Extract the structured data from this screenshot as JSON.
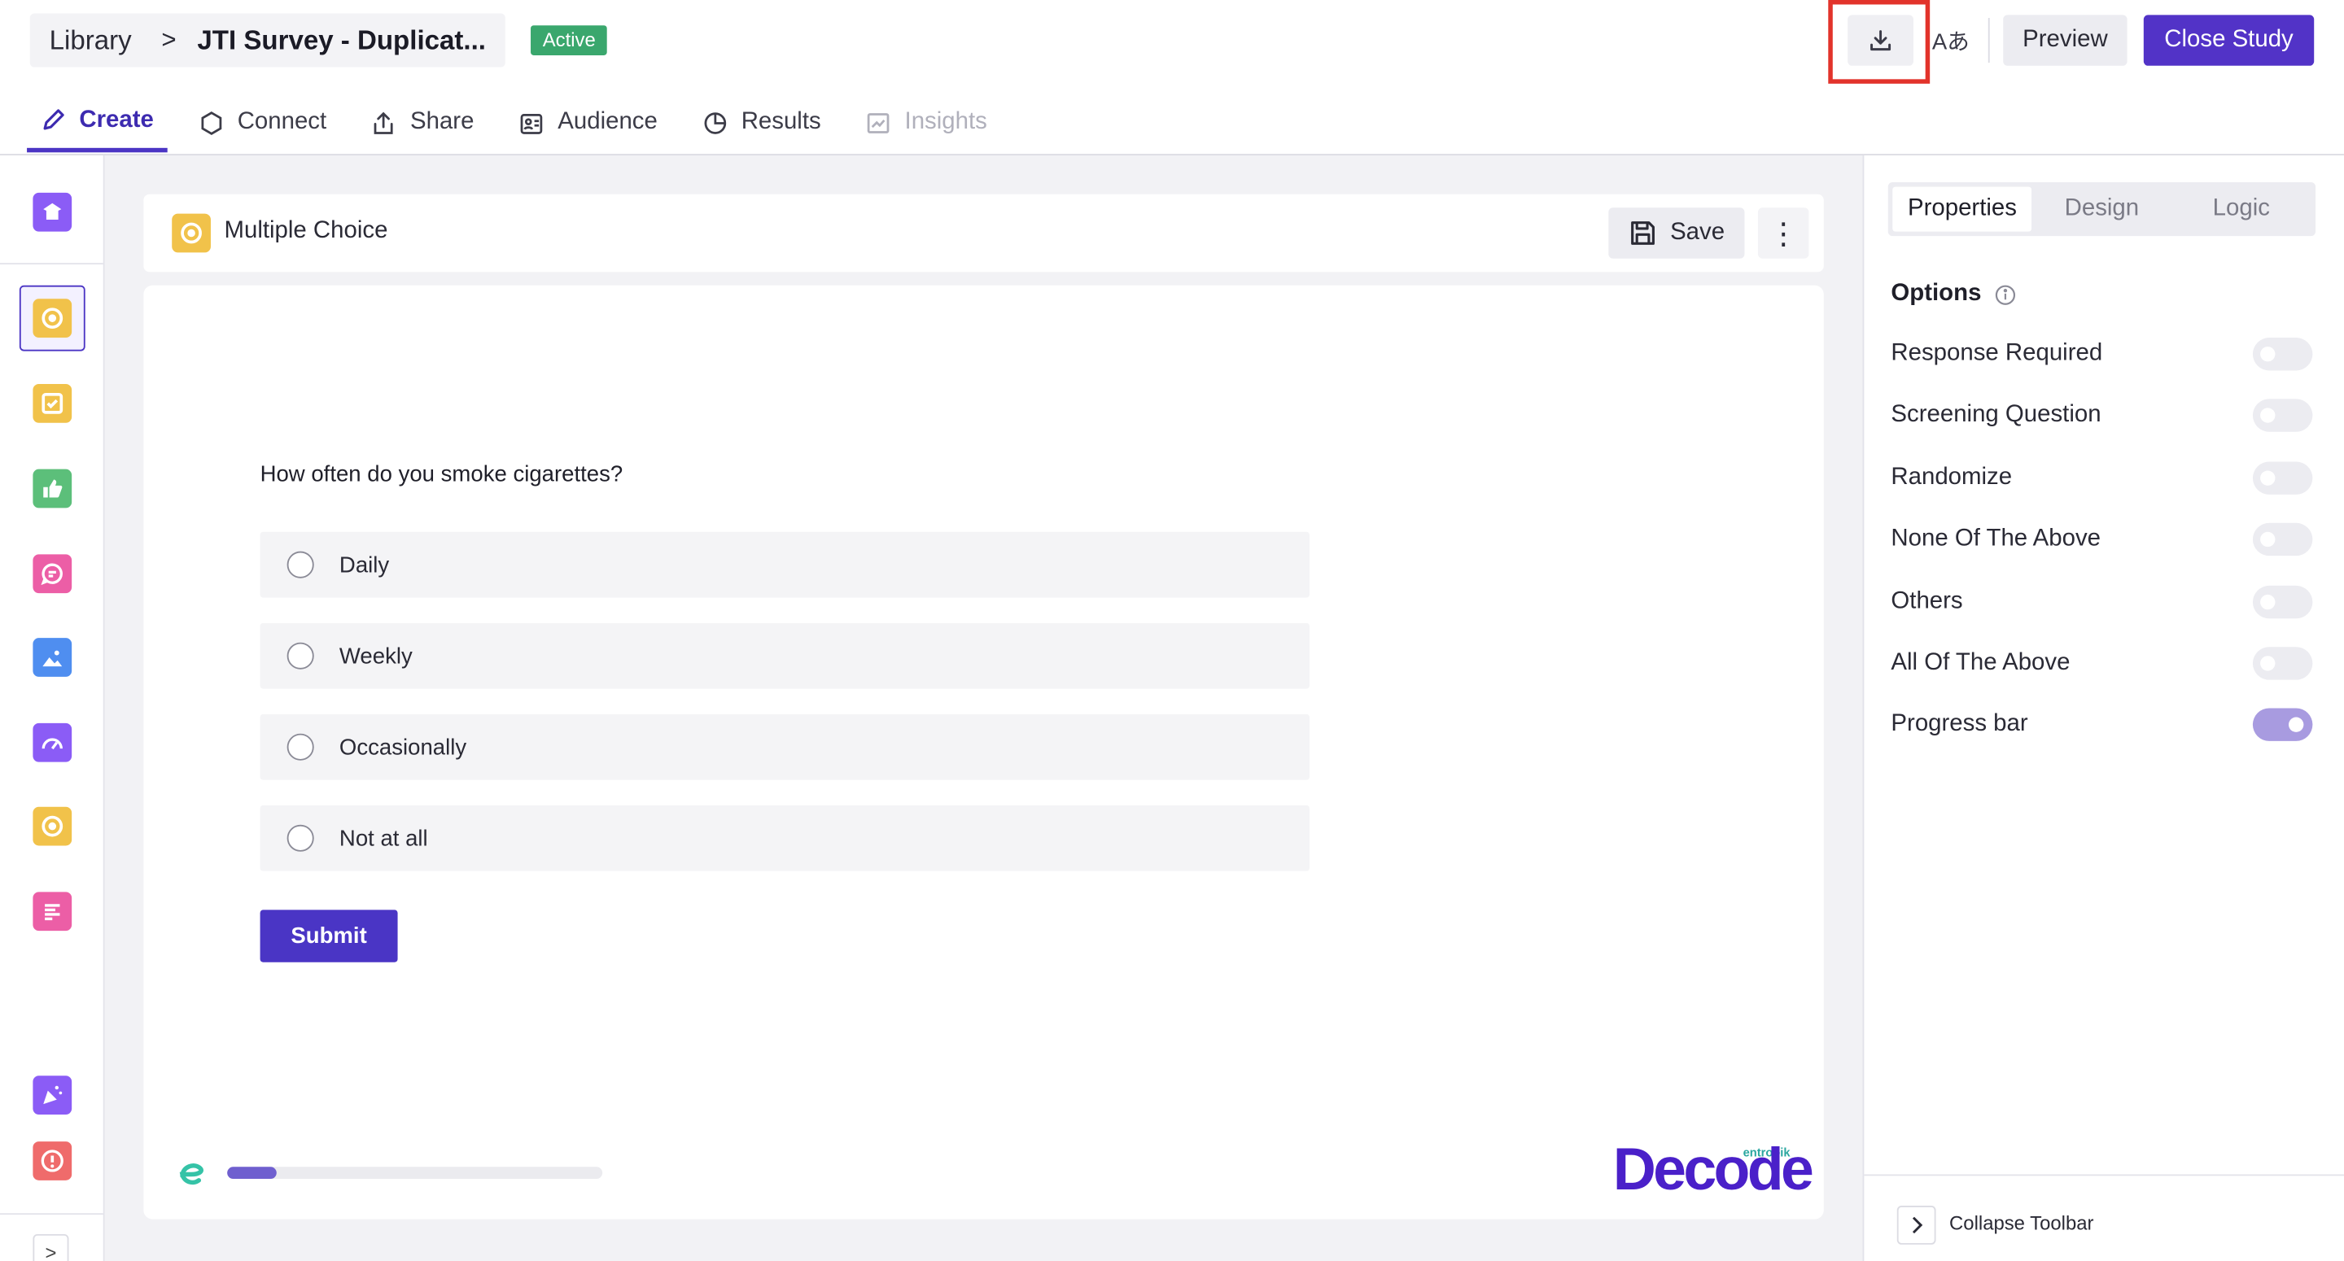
{
  "header": {
    "breadcrumb_root": "Library",
    "breadcrumb_sep": ">",
    "study_title": "JTI Survey - Duplicat...",
    "status_badge": "Active",
    "translate_label": "Aあ",
    "preview_label": "Preview",
    "close_study_label": "Close Study"
  },
  "tabs": [
    {
      "label": "Create",
      "icon": "pencil-icon",
      "state": "active"
    },
    {
      "label": "Connect",
      "icon": "hexagon-icon",
      "state": "normal"
    },
    {
      "label": "Share",
      "icon": "share-icon",
      "state": "normal"
    },
    {
      "label": "Audience",
      "icon": "audience-icon",
      "state": "normal"
    },
    {
      "label": "Results",
      "icon": "pie-icon",
      "state": "normal"
    },
    {
      "label": "Insights",
      "icon": "chart-icon",
      "state": "disabled"
    }
  ],
  "rail": {
    "items": [
      {
        "icon": "welcome-icon",
        "color": "#8b5cf6"
      },
      {
        "icon": "multiple-choice-icon",
        "color": "#f1c24a",
        "selected": true
      },
      {
        "icon": "checkbox-icon",
        "color": "#f1c24a"
      },
      {
        "icon": "thumbs-up-icon",
        "color": "#5cbf7a"
      },
      {
        "icon": "chat-icon",
        "color": "#ec5ea6"
      },
      {
        "icon": "image-icon",
        "color": "#4f8ef0"
      },
      {
        "icon": "gauge-icon",
        "color": "#8b5cf6"
      },
      {
        "icon": "target-icon",
        "color": "#f1c24a"
      },
      {
        "icon": "text-icon",
        "color": "#ec5ea6"
      },
      {
        "icon": "celebration-icon",
        "color": "#8b5cf6"
      },
      {
        "icon": "alert-icon",
        "color": "#ef6b6b"
      }
    ],
    "expand_label": ">"
  },
  "question_bar": {
    "type_label": "Multiple Choice",
    "save_label": "Save",
    "more_label": "⋮"
  },
  "question": {
    "text": "How often do you smoke cigarettes?",
    "options": [
      "Daily",
      "Weekly",
      "Occasionally",
      "Not at all"
    ],
    "submit_label": "Submit",
    "progress": 0.13
  },
  "branding": {
    "small": "entropik",
    "logo": "Decode"
  },
  "panel": {
    "tabs": [
      "Properties",
      "Design",
      "Logic"
    ],
    "active_tab": "Properties",
    "options_heading": "Options",
    "properties": [
      {
        "label": "Response Required",
        "on": false
      },
      {
        "label": "Screening Question",
        "on": false
      },
      {
        "label": "Randomize",
        "on": false
      },
      {
        "label": "None Of The Above",
        "on": false
      },
      {
        "label": "Others",
        "on": false
      },
      {
        "label": "All Of The Above",
        "on": false
      },
      {
        "label": "Progress bar",
        "on": true
      }
    ],
    "collapse_label": "Collapse Toolbar"
  },
  "colors": {
    "accent": "#4a35c5",
    "active_badge": "#3aa76d",
    "highlight": "#e2332b"
  }
}
